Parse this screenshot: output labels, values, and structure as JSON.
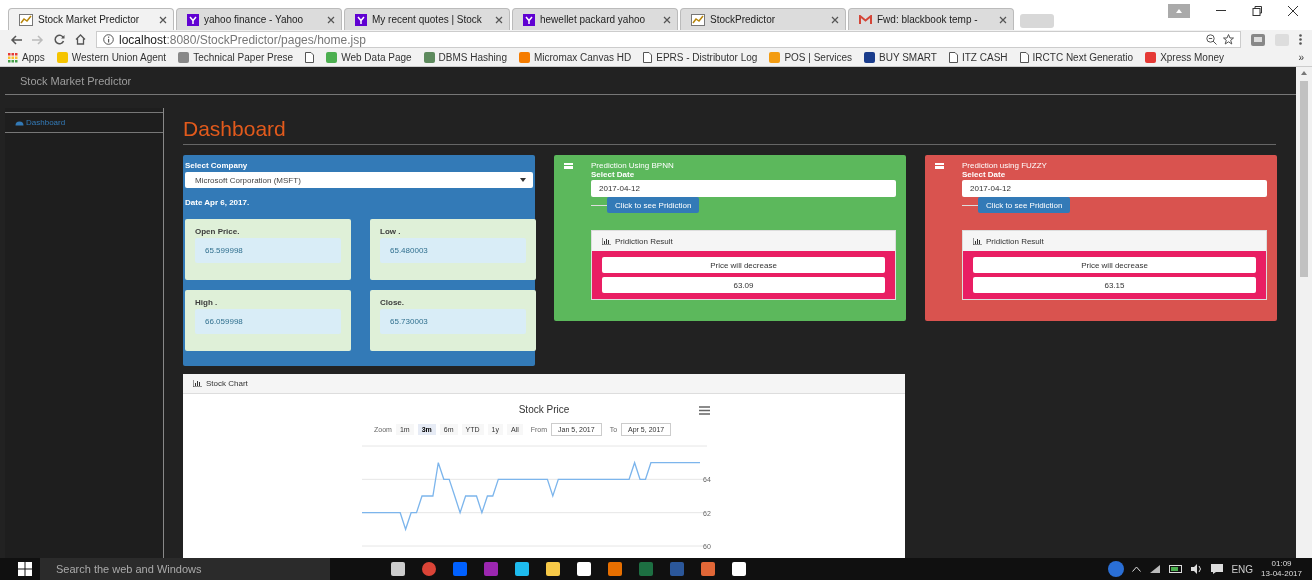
{
  "browser": {
    "tabs": [
      {
        "title": "Stock Market Predictor",
        "selected": true
      },
      {
        "title": "yahoo finance - Yahoo",
        "selected": false
      },
      {
        "title": "My recent quotes | Stock",
        "selected": false
      },
      {
        "title": "hewellet packard yahoo",
        "selected": false
      },
      {
        "title": "StockPredictor",
        "selected": false
      },
      {
        "title": "Fwd: blackbook temp -",
        "selected": false
      }
    ],
    "address": {
      "host": "localhost",
      "path": ":8080/StockPredictor/pages/home.jsp"
    },
    "bookmarks": [
      "Apps",
      "Western Union Agent",
      "Technical Paper Prese",
      "Web Data Page",
      "DBMS Hashing",
      "Micromax Canvas HD",
      "EPRS - Distributor Log",
      "POS | Services",
      "BUY SMART",
      "ITZ CASH",
      "IRCTC Next Generatio",
      "Xpress Money"
    ],
    "more": "»"
  },
  "page": {
    "brand": "Stock Market Predictor",
    "sidebar": {
      "items": [
        {
          "label": "Dashboard",
          "selected": true
        }
      ]
    },
    "heading": "Dashboard",
    "company_card": {
      "label": "Select Company",
      "select_value": "Microsoft Corporation (MSFT)",
      "date": "Date Apr 6, 2017.",
      "prices": [
        {
          "label": "Open Price.",
          "value": "65.599998"
        },
        {
          "label": "Low .",
          "value": "65.480003"
        },
        {
          "label": "High .",
          "value": "66.059998"
        },
        {
          "label": "Close.",
          "value": "65.730003"
        }
      ]
    },
    "prediction_cards": [
      {
        "title": "Prediction Using BPNN",
        "date_label": "Select Date",
        "date_value": "2017-04-12",
        "button": "Click to see Pridiction",
        "result_title": "Pridiction Result",
        "result_text": "Price will decrease",
        "result_value": "63.09",
        "color": "#5cb85c"
      },
      {
        "title": "Prediction using FUZZY",
        "date_label": "Select Date",
        "date_value": "2017-04-12",
        "button": "Click to see Pridiction",
        "result_title": "Pridiction Result",
        "result_text": "Price will decrease",
        "result_value": "63.15",
        "color": "#d9534f"
      }
    ],
    "chart_panel": {
      "title": "Stock Chart",
      "range_selector": {
        "zoom_label": "Zoom",
        "buttons": [
          {
            "label": "1m",
            "selected": false
          },
          {
            "label": "3m",
            "selected": true
          },
          {
            "label": "6m",
            "selected": false
          },
          {
            "label": "YTD",
            "selected": false
          },
          {
            "label": "1y",
            "selected": false
          },
          {
            "label": "All",
            "selected": false
          }
        ],
        "from_label": "From",
        "from": "Jan 5, 2017",
        "to_label": "To",
        "to": "Apr 5, 2017"
      },
      "chart_data": {
        "type": "line",
        "title": "Stock Price",
        "ylim": [
          60,
          66
        ],
        "yticks": [
          60,
          62,
          64
        ],
        "values": [
          62,
          62,
          62,
          62,
          62,
          62,
          62,
          62,
          61,
          62,
          62,
          63,
          63,
          63,
          65,
          64,
          64,
          63,
          62,
          63,
          63,
          63,
          62,
          63,
          63,
          64,
          64,
          64,
          64,
          64,
          64,
          64,
          64,
          64,
          64,
          63,
          64,
          64,
          64,
          64,
          64,
          64,
          64,
          64,
          64,
          64,
          64,
          64,
          64,
          64,
          65,
          64,
          64,
          65,
          65,
          65,
          65,
          65,
          65,
          65,
          65,
          65,
          65
        ]
      }
    }
  },
  "taskbar": {
    "search_placeholder": "Search the web and Windows",
    "language": "ENG",
    "time": "01:09",
    "date": "13-04-2017"
  }
}
